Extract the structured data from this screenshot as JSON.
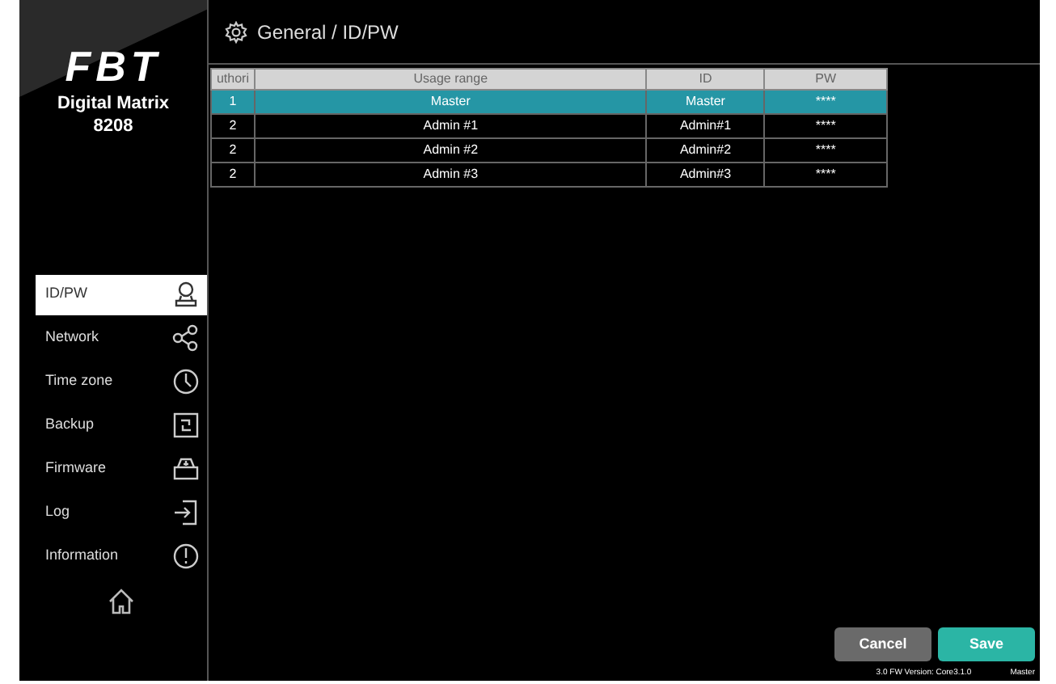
{
  "brand": {
    "logo": "FBT",
    "product": "Digital Matrix",
    "model": "8208"
  },
  "sidebar": {
    "items": [
      {
        "label": "ID/PW",
        "kind": "user",
        "selected": true
      },
      {
        "label": "Network",
        "kind": "network",
        "selected": false
      },
      {
        "label": "Time zone",
        "kind": "clock",
        "selected": false
      },
      {
        "label": "Backup",
        "kind": "backup",
        "selected": false
      },
      {
        "label": "Firmware",
        "kind": "firmware",
        "selected": false
      },
      {
        "label": "Log",
        "kind": "log",
        "selected": false
      },
      {
        "label": "Information",
        "kind": "info",
        "selected": false
      }
    ]
  },
  "breadcrumb": "General / ID/PW",
  "table": {
    "columns": [
      "uthori",
      "Usage range",
      "ID",
      "PW"
    ],
    "rows": [
      {
        "cells": [
          "1",
          "Master",
          "Master",
          "****"
        ],
        "selected": true
      },
      {
        "cells": [
          "2",
          "Admin #1",
          "Admin#1",
          "****"
        ],
        "selected": false
      },
      {
        "cells": [
          "2",
          "Admin #2",
          "Admin#2",
          "****"
        ],
        "selected": false
      },
      {
        "cells": [
          "2",
          "Admin #3",
          "Admin#3",
          "****"
        ],
        "selected": false
      }
    ]
  },
  "buttons": [
    {
      "label": "Cancel",
      "kind": "secondary"
    },
    {
      "label": "Save",
      "kind": "primary"
    }
  ],
  "footer": {
    "version": "3.0 FW Version: Core3.1.0",
    "user": "Master"
  }
}
